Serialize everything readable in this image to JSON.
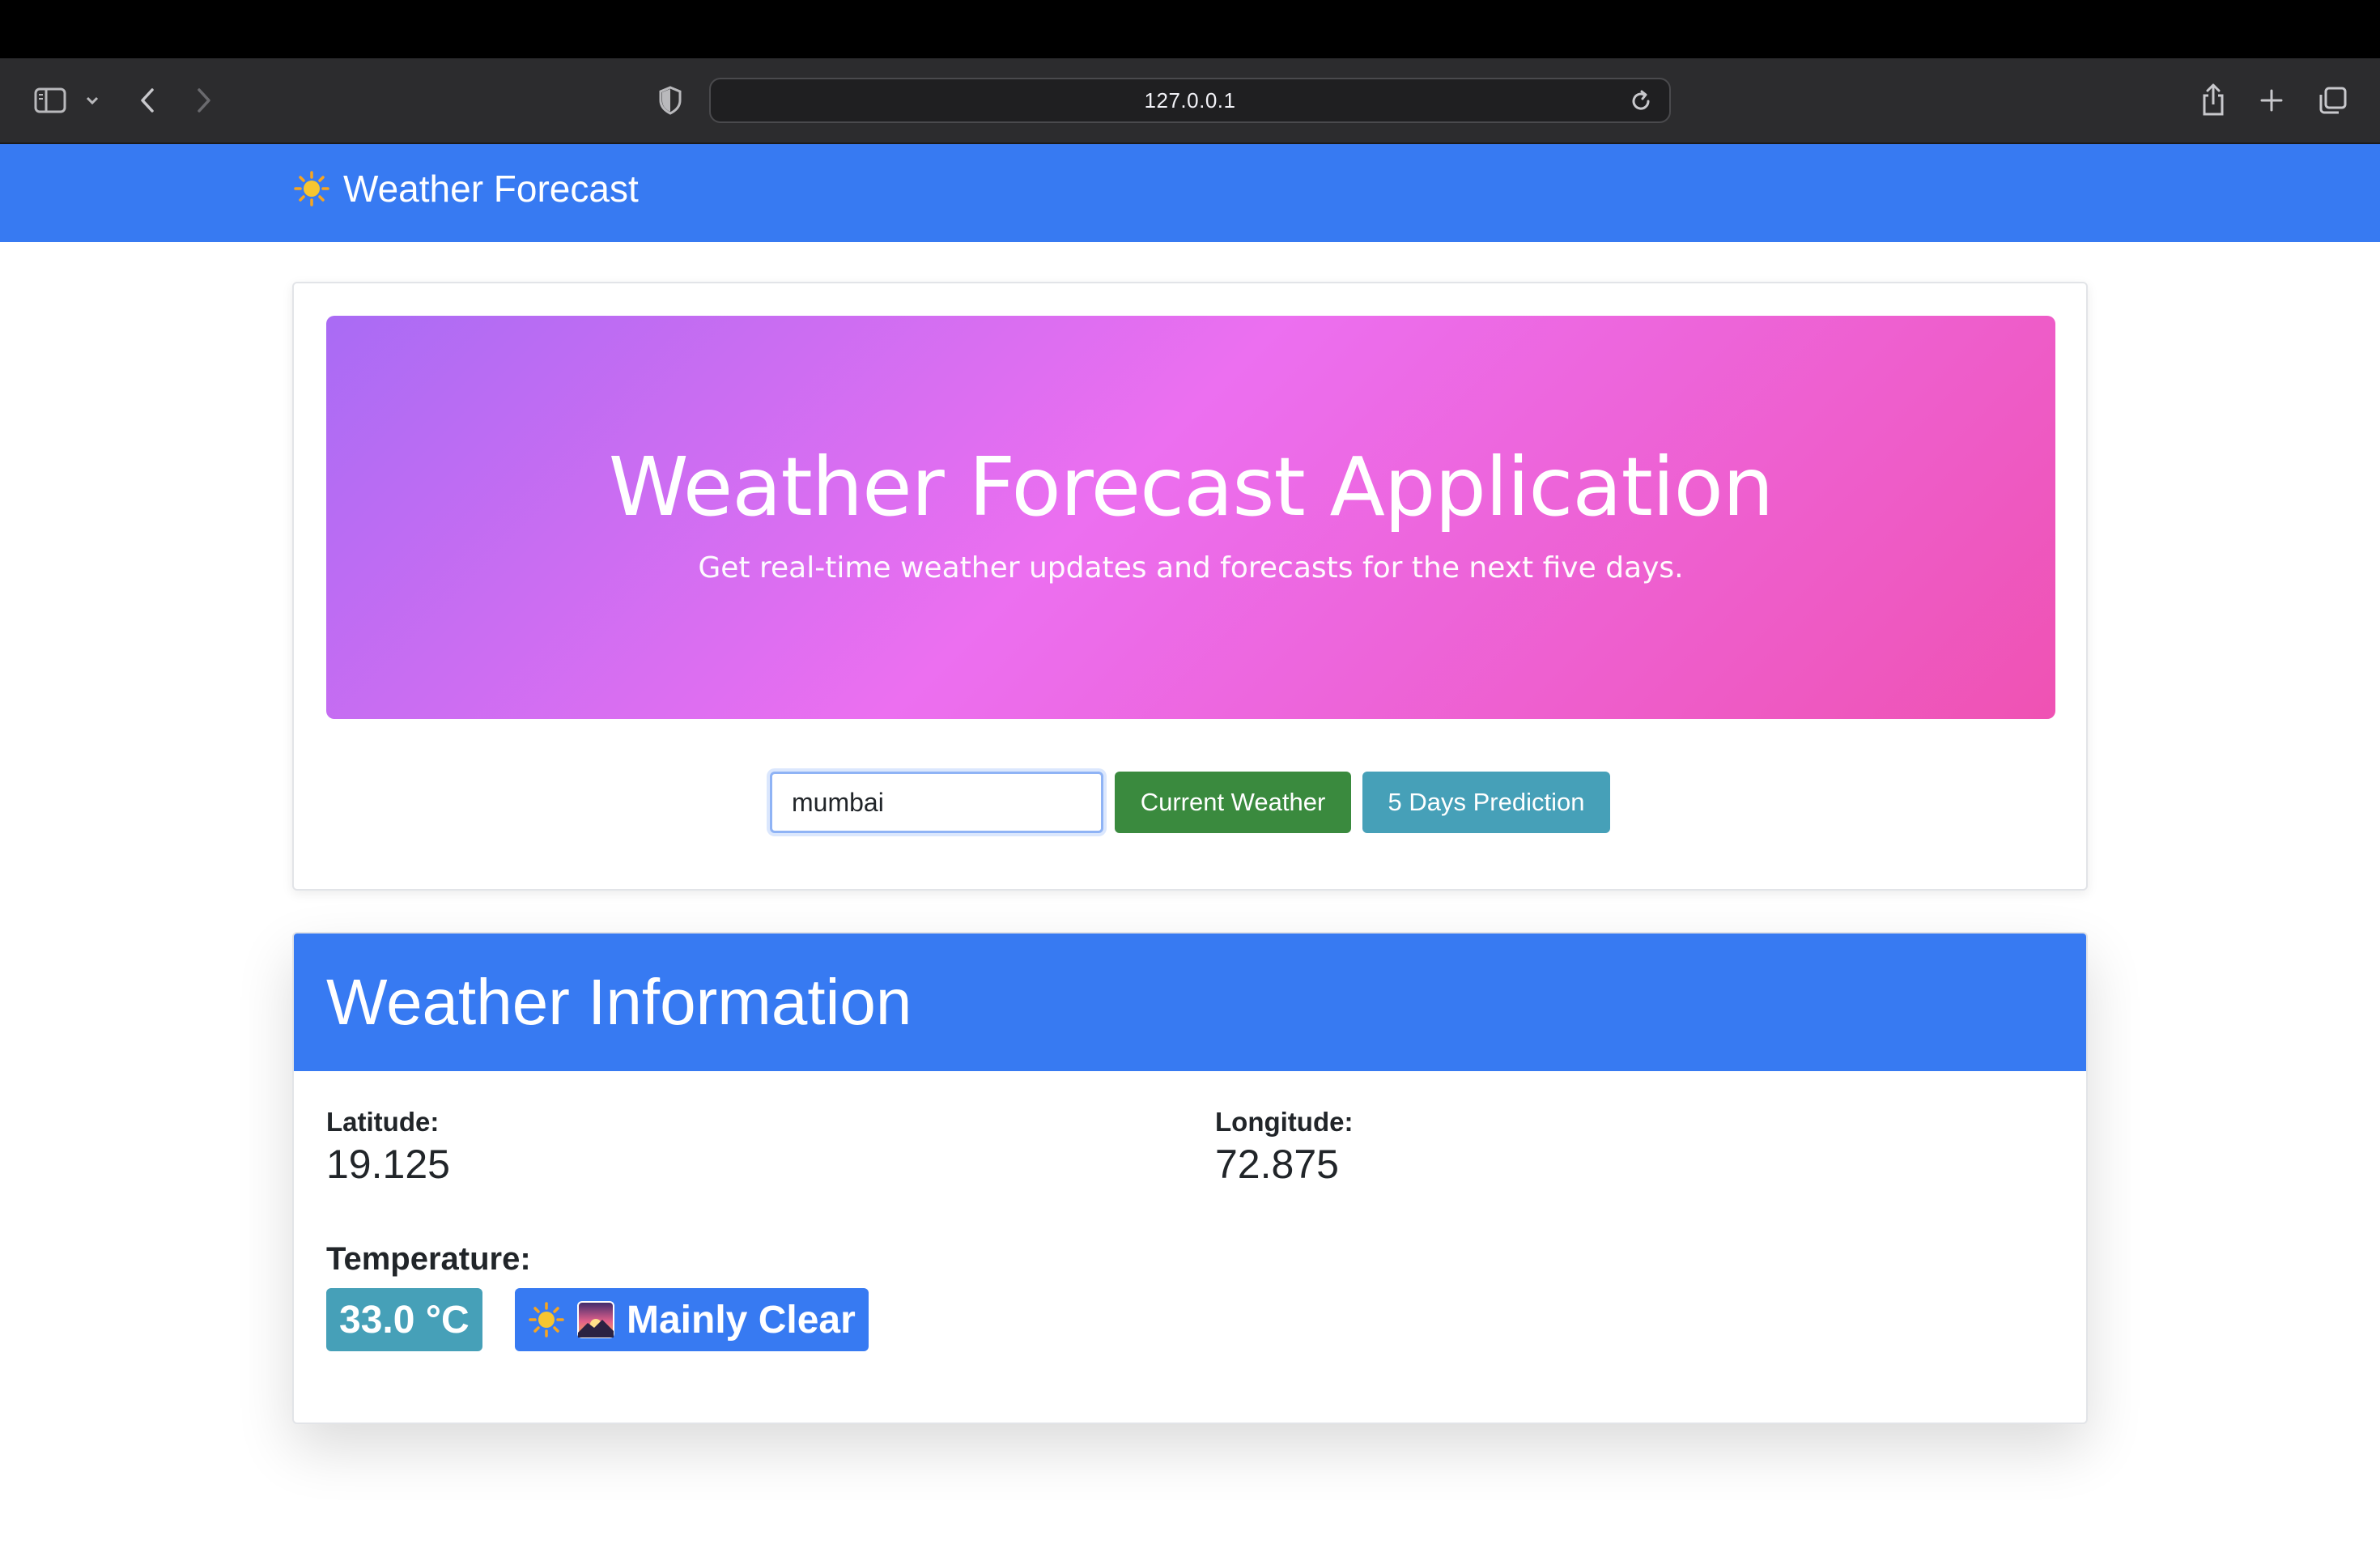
{
  "browser": {
    "url": "127.0.0.1",
    "icons": [
      "sidebar-icon",
      "chevron-down-icon",
      "back-icon",
      "forward-icon",
      "shield-icon",
      "reload-icon",
      "share-icon",
      "new-tab-icon",
      "tabs-overview-icon"
    ]
  },
  "navbar": {
    "brand_icon": "sun-icon",
    "brand_text": "Weather Forecast"
  },
  "hero": {
    "title": "Weather Forecast Application",
    "subtitle": "Get real-time weather updates and forecasts for the next five days."
  },
  "search": {
    "city_value": "mumbai",
    "current_label": "Current Weather",
    "predict_label": "5 Days Prediction"
  },
  "info": {
    "title": "Weather Information",
    "latitude_label": "Latitude:",
    "latitude_value": "19.125",
    "longitude_label": "Longitude:",
    "longitude_value": "72.875",
    "temperature_label": "Temperature:",
    "temperature_value": "33.0 °C",
    "condition_icons": [
      "sun-icon",
      "sunrise-icon"
    ],
    "condition_text": "Mainly Clear"
  },
  "colors": {
    "primary": "#377af2",
    "success": "#3a8a3e",
    "info": "#46a0b8"
  }
}
